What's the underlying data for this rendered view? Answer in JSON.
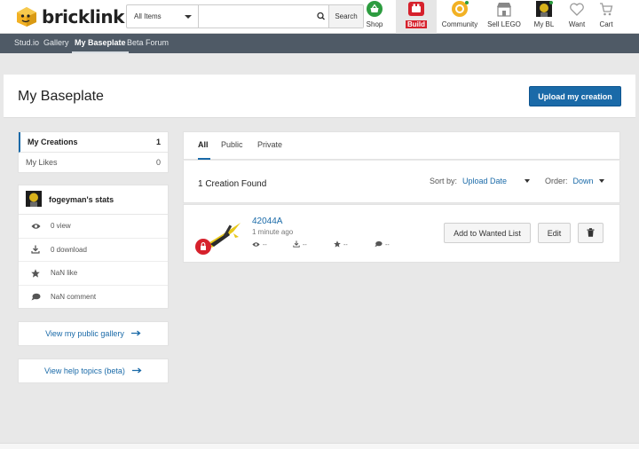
{
  "header": {
    "logo_text": "bricklink",
    "search": {
      "category": "All Items",
      "placeholder": "",
      "button": "Search"
    },
    "nav": [
      {
        "label": "Shop"
      },
      {
        "label": "Build"
      },
      {
        "label": "Community"
      },
      {
        "label": "Sell LEGO"
      },
      {
        "label": "My BL"
      },
      {
        "label": "Want"
      },
      {
        "label": "Cart"
      }
    ],
    "colors": {
      "shop": "#2c9c3f",
      "build": "#d6212c",
      "community": "#f2b124"
    }
  },
  "subnav": [
    {
      "label": "Stud.io"
    },
    {
      "label": "Gallery"
    },
    {
      "label": "My Baseplate"
    },
    {
      "label": "Beta Forum"
    }
  ],
  "page": {
    "title": "My Baseplate",
    "upload_button": "Upload my creation"
  },
  "sidebar": {
    "tabs": [
      {
        "label": "My Creations",
        "count": "1"
      },
      {
        "label": "My Likes",
        "count": "0"
      }
    ],
    "stats": {
      "title": "fogeyman's stats",
      "rows": [
        {
          "icon": "eye-icon",
          "text": "0 view"
        },
        {
          "icon": "download-icon",
          "text": "0 download"
        },
        {
          "icon": "star-icon",
          "text": "NaN like"
        },
        {
          "icon": "comment-icon",
          "text": "NaN comment"
        }
      ]
    },
    "links": [
      {
        "label": "View my public gallery"
      },
      {
        "label": "View help topics (beta)"
      }
    ]
  },
  "filters": {
    "tabs": [
      "All",
      "Public",
      "Private"
    ]
  },
  "results": {
    "count_text": "1 Creation Found",
    "sort_label": "Sort by:",
    "sort_value": "Upload Date",
    "order_label": "Order:",
    "order_value": "Down"
  },
  "creation": {
    "title": "42044A",
    "time": "1 minute ago",
    "stats": [
      "--",
      "--",
      "--",
      "--"
    ],
    "buttons": {
      "wanted": "Add to Wanted List",
      "edit": "Edit"
    }
  }
}
